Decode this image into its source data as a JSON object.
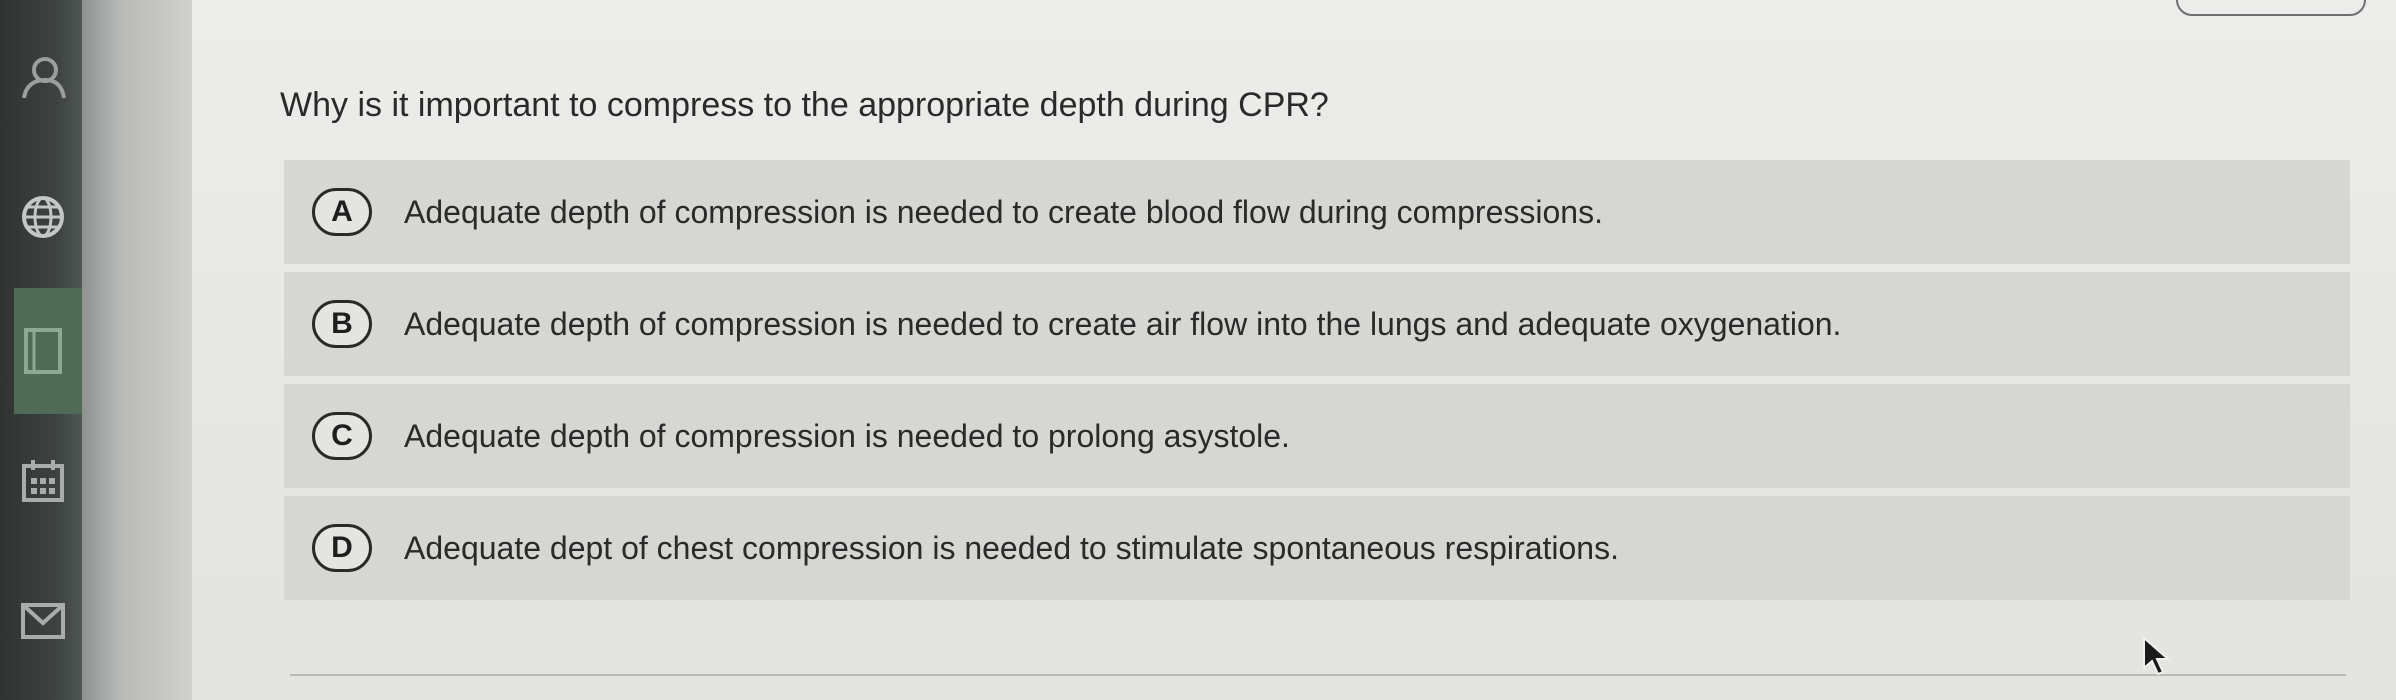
{
  "sidebar": {
    "icons": [
      "user-icon",
      "globe-icon",
      "book-icon",
      "calendar-icon",
      "mail-icon"
    ]
  },
  "question": {
    "text": "Why is it important to compress to the appropriate depth during CPR?"
  },
  "options": [
    {
      "letter": "A",
      "text": "Adequate depth of compression is needed to create blood flow during compressions."
    },
    {
      "letter": "B",
      "text": "Adequate depth of compression is needed to create air flow into the lungs and adequate oxygenation."
    },
    {
      "letter": "C",
      "text": "Adequate depth of compression is needed to prolong asystole."
    },
    {
      "letter": "D",
      "text": "Adequate dept of chest compression is needed to stimulate spontaneous respirations."
    }
  ]
}
